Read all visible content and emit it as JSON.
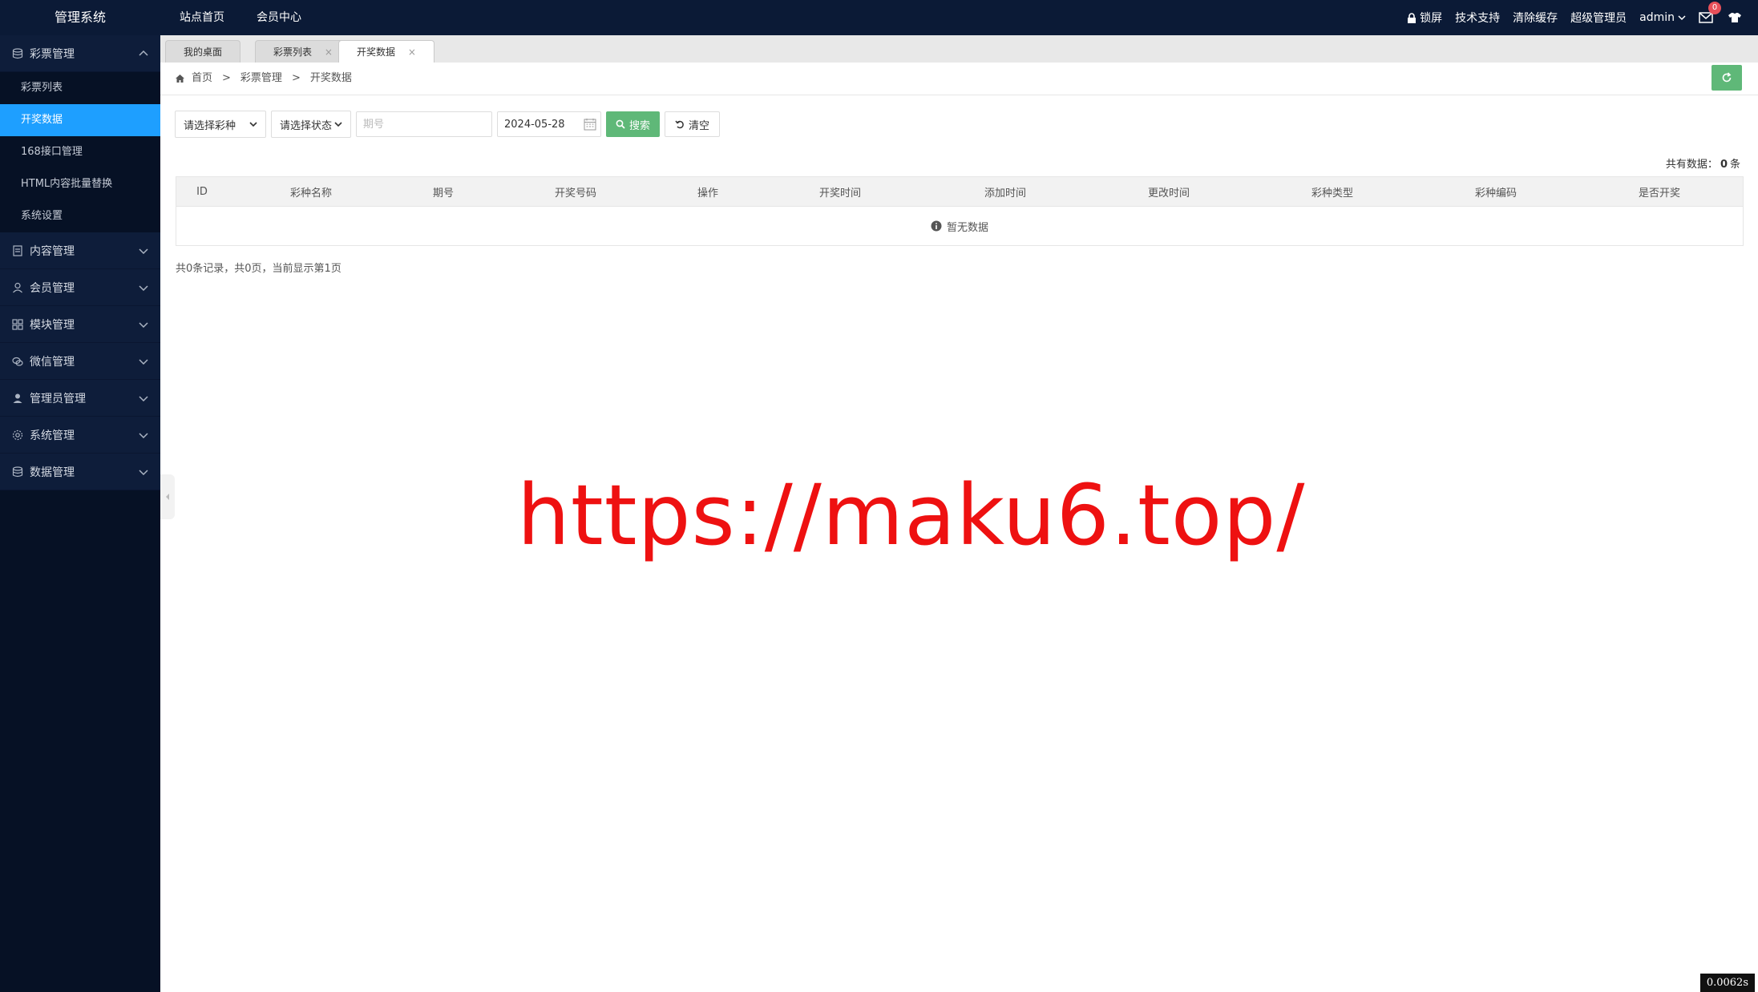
{
  "header": {
    "logo": "管理系统",
    "nav": [
      "站点首页",
      "会员中心"
    ],
    "right": {
      "lock": "锁屏",
      "support": "技术支持",
      "clear_cache": "清除缓存",
      "role": "超级管理员",
      "user": "admin",
      "mail_badge": "0"
    }
  },
  "sidebar": {
    "groups": [
      {
        "label": "彩票管理",
        "icon": "database-icon",
        "expanded": true,
        "items": [
          "彩票列表",
          "开奖数据",
          "168接口管理",
          "HTML内容批量替换",
          "系统设置"
        ],
        "active_index": 1
      },
      {
        "label": "内容管理",
        "icon": "document-icon"
      },
      {
        "label": "会员管理",
        "icon": "user-icon"
      },
      {
        "label": "模块管理",
        "icon": "grid-icon"
      },
      {
        "label": "微信管理",
        "icon": "wechat-icon"
      },
      {
        "label": "管理员管理",
        "icon": "admin-icon"
      },
      {
        "label": "系统管理",
        "icon": "gear-icon"
      },
      {
        "label": "数据管理",
        "icon": "database-icon"
      }
    ]
  },
  "tabs": [
    {
      "label": "我的桌面",
      "closable": false
    },
    {
      "label": "彩票列表",
      "closable": true
    },
    {
      "label": "开奖数据",
      "closable": true,
      "active": true
    }
  ],
  "breadcrumb": {
    "home": "首页",
    "level1": "彩票管理",
    "level2": "开奖数据",
    "sep": ">"
  },
  "filters": {
    "lottery_select": "请选择彩种",
    "status_select": "请选择状态",
    "issue_placeholder": "期号",
    "date_value": "2024-05-28",
    "search_label": "搜索",
    "clear_label": "清空"
  },
  "summary": {
    "prefix": "共有数据：",
    "count": "0",
    "suffix": "条"
  },
  "table": {
    "columns": [
      "ID",
      "彩种名称",
      "期号",
      "开奖号码",
      "操作",
      "开奖时间",
      "添加时间",
      "更改时间",
      "彩种类型",
      "彩种编码",
      "是否开奖"
    ],
    "empty_text": "暂无数据"
  },
  "pager_text": "共0条记录，共0页，当前显示第1页",
  "watermark": "https://maku6.top/",
  "timer": "0.0062s"
}
